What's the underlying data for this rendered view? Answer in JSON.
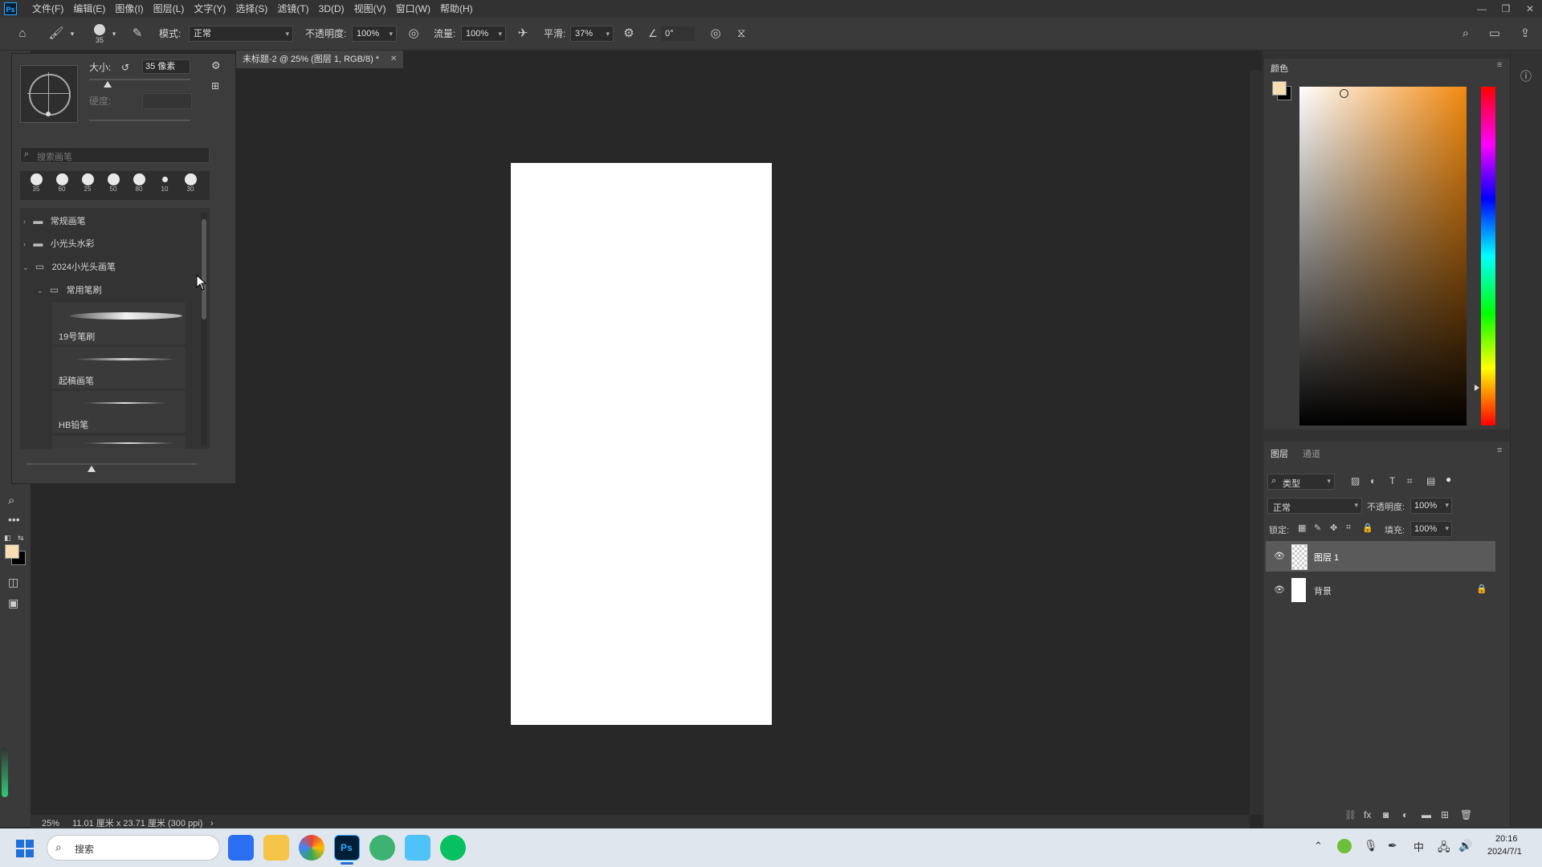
{
  "menubar": {
    "logo": "Ps",
    "menus": [
      "文件(F)",
      "编辑(E)",
      "图像(I)",
      "图层(L)",
      "文字(Y)",
      "选择(S)",
      "滤镜(T)",
      "3D(D)",
      "视图(V)",
      "窗口(W)",
      "帮助(H)"
    ]
  },
  "options": {
    "brush_size_small": "35",
    "mode_label": "模式:",
    "mode_value": "正常",
    "opacity_label": "不透明度:",
    "opacity_value": "100%",
    "flow_label": "流量:",
    "flow_value": "100%",
    "smooth_label": "平滑:",
    "smooth_value": "37%",
    "angle_value": "0°"
  },
  "brush_panel": {
    "size_label": "大小:",
    "size_value": "35 像素",
    "hardness_label": "硬度:",
    "search_placeholder": "搜索画笔",
    "presets": [
      "35",
      "60",
      "25",
      "50",
      "80",
      "10",
      "30"
    ],
    "tree": {
      "folder1": "常规画笔",
      "folder2": "小光头水彩",
      "folder3": "2024小光头画笔",
      "subfolder": "常用笔刷",
      "brush1": "19号笔刷",
      "brush2": "起稿画笔",
      "brush3": "HB铅笔"
    }
  },
  "document": {
    "tab_title": "未标题-2 @ 25% (图层 1, RGB/8) *",
    "status_zoom": "25%",
    "status_info": "11.01 厘米 x 23.71 厘米 (300 ppi)"
  },
  "color_panel": {
    "title": "颜色",
    "foreground": "#f5deb3",
    "background": "#000000"
  },
  "layers_panel": {
    "tabs": [
      "图层",
      "通道"
    ],
    "filter_label": "类型",
    "blend_mode": "正常",
    "opacity_label": "不透明度:",
    "opacity_value": "100%",
    "lock_label": "锁定:",
    "fill_label": "填充:",
    "fill_value": "100%",
    "layers": [
      {
        "name": "图层 1"
      },
      {
        "name": "背景"
      }
    ]
  },
  "taskbar": {
    "search_placeholder": "搜索",
    "ime": "中",
    "time": "20:16",
    "date": "2024/7/1"
  }
}
